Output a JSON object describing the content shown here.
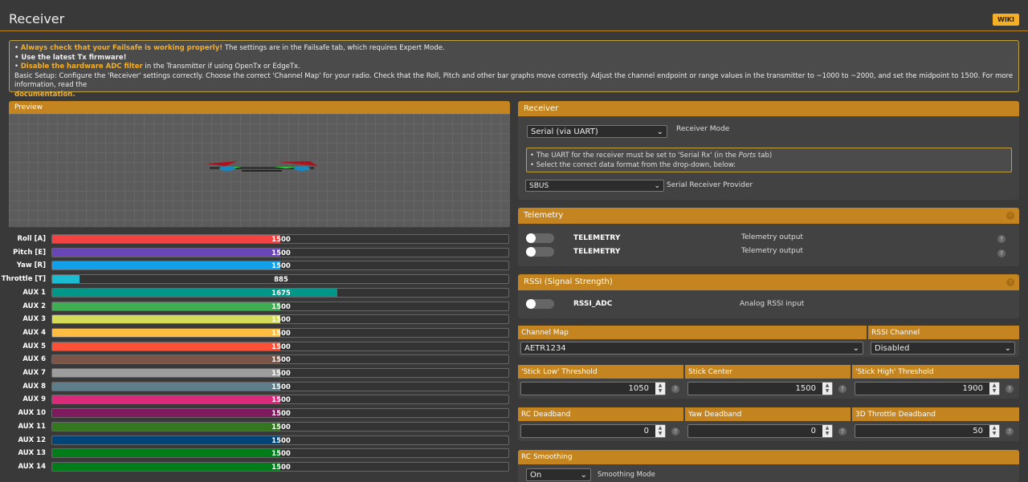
{
  "header": {
    "title": "Receiver",
    "wiki_label": "WIKI"
  },
  "notice": {
    "line1_hl": "Always check that your Failsafe is working properly!",
    "line1_rest": " The settings are in the Failsafe tab, which requires Expert Mode.",
    "line2": "Use the latest Tx firmware!",
    "line3_hl": "Disable the hardware ADC filter",
    "line3_rest": " in the Transmitter if using OpenTx or EdgeTx.",
    "line4": "Basic Setup: Configure the 'Receiver' settings correctly. Choose the correct 'Channel Map' for your radio. Check that the Roll, Pitch and other bar graphs move correctly. Adjust the channel endpoint or range values in the transmitter to ~1000 to ~2000, and set the midpoint to 1500. For more information, read the",
    "link": "documentation."
  },
  "preview": {
    "title": "Preview"
  },
  "channel_range": [
    800,
    2200
  ],
  "channels": [
    {
      "label": "Roll [A]",
      "value": 1500,
      "color": "#f44242"
    },
    {
      "label": "Pitch [E]",
      "value": 1500,
      "color": "#6a45b5"
    },
    {
      "label": "Yaw [R]",
      "value": 1500,
      "color": "#11a0ea"
    },
    {
      "label": "Throttle [T]",
      "value": 885,
      "color": "#1bbcd1"
    },
    {
      "label": "AUX 1",
      "value": 1675,
      "color": "#009688"
    },
    {
      "label": "AUX 2",
      "value": 1500,
      "color": "#41ad52"
    },
    {
      "label": "AUX 3",
      "value": 1500,
      "color": "#d3db58"
    },
    {
      "label": "AUX 4",
      "value": 1500,
      "color": "#fdbd43"
    },
    {
      "label": "AUX 5",
      "value": 1500,
      "color": "#fd5036"
    },
    {
      "label": "AUX 6",
      "value": 1500,
      "color": "#7a5548"
    },
    {
      "label": "AUX 7",
      "value": 1500,
      "color": "#9d9d9d"
    },
    {
      "label": "AUX 8",
      "value": 1500,
      "color": "#5f7e8b"
    },
    {
      "label": "AUX 9",
      "value": 1500,
      "color": "#dc2a7a"
    },
    {
      "label": "AUX 10",
      "value": 1500,
      "color": "#7e1a5e"
    },
    {
      "label": "AUX 11",
      "value": 1500,
      "color": "#33771f"
    },
    {
      "label": "AUX 12",
      "value": 1500,
      "color": "#004478"
    },
    {
      "label": "AUX 13",
      "value": 1500,
      "color": "#007d18"
    },
    {
      "label": "AUX 14",
      "value": 1500,
      "color": "#007d18"
    }
  ],
  "receiver": {
    "title": "Receiver",
    "mode": "Serial (via UART)",
    "mode_label": "Receiver Mode",
    "info1a": "The UART for the receiver must be set to 'Serial Rx' (in the ",
    "info1_em": "Ports",
    "info1b": " tab)",
    "info2": "Select the correct data format from the drop-down, below:",
    "provider": "SBUS",
    "provider_label": "Serial Receiver Provider"
  },
  "telemetry": {
    "title": "Telemetry",
    "items": [
      {
        "name": "TELEMETRY",
        "desc": "Telemetry output"
      },
      {
        "name": "TELEMETRY",
        "desc": "Telemetry output"
      }
    ]
  },
  "rssi": {
    "title": "RSSI (Signal Strength)",
    "name": "RSSI_ADC",
    "desc": "Analog RSSI input"
  },
  "channel_map": {
    "label": "Channel Map",
    "value": "AETR1234",
    "rssi_label": "RSSI Channel",
    "rssi_value": "Disabled"
  },
  "thresholds": [
    {
      "label": "'Stick Low' Threshold",
      "value": "1050"
    },
    {
      "label": "Stick Center",
      "value": "1500"
    },
    {
      "label": "'Stick High' Threshold",
      "value": "1900"
    }
  ],
  "deadbands": [
    {
      "label": "RC Deadband",
      "value": "0"
    },
    {
      "label": "Yaw Deadband",
      "value": "0"
    },
    {
      "label": "3D Throttle Deadband",
      "value": "50"
    }
  ],
  "smoothing": {
    "title": "RC Smoothing",
    "mode": "On",
    "mode_label": "Smoothing Mode"
  }
}
